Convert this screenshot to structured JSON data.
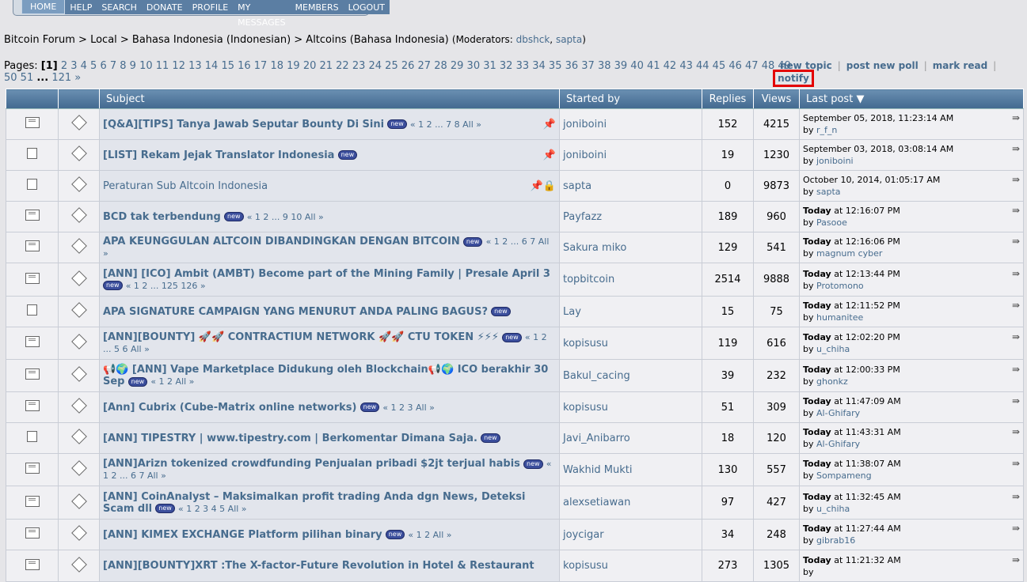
{
  "menu": [
    "HOME",
    "HELP",
    "SEARCH",
    "DONATE",
    "PROFILE",
    "MY MESSAGES",
    "MEMBERS",
    "LOGOUT"
  ],
  "breadcrumb": {
    "path": "Bitcoin Forum > Local > Bahasa Indonesia (Indonesian) > Altcoins (Bahasa Indonesia)",
    "mods_prefix": "(Moderators: ",
    "mod1": "dbshck",
    "mod_sep": ", ",
    "mod2": "sapta",
    "mods_suffix": ")"
  },
  "pages": {
    "label": "Pages:",
    "current": "[1]",
    "list": "2 3 4 5 6 7 8 9 10 11 12 13 14 15 16 17 18 19 20 21 22 23 24 25 26 27 28 29 30 31 32 33 34 35 36 37 38 39 40 41 42 43 44 45 46 47 48 49",
    "list2": "50 51",
    "ellipsis": "...",
    "last": "121 »"
  },
  "actions": {
    "new_topic": "new topic",
    "new_poll": "post new poll",
    "mark_read": "mark read",
    "notify": "notify",
    "sep": "|"
  },
  "columns": {
    "subject": "Subject",
    "started_by": "Started by",
    "replies": "Replies",
    "views": "Views",
    "last_post": "Last post"
  },
  "topics": [
    {
      "subject": "[Q&A][TIPS] Tanya Jawab Seputar Bounty Di Sini",
      "new": true,
      "pages": "« 1 2 ... 7 8  All »",
      "pinned": true,
      "locked": false,
      "plain": false,
      "starter": "joniboini",
      "replies": "152",
      "views": "4215",
      "last_date": "September 05, 2018, 11:23:14 AM",
      "last_by": "r_f_n",
      "today": false,
      "hot": true
    },
    {
      "subject": "[LIST] Rekam Jejak Translator Indonesia",
      "new": true,
      "pages": "",
      "pinned": true,
      "locked": false,
      "plain": false,
      "starter": "joniboini",
      "replies": "19",
      "views": "1230",
      "last_date": "September 03, 2018, 03:08:14 AM",
      "last_by": "joniboini",
      "today": false,
      "hot": false
    },
    {
      "subject": "Peraturan Sub Altcoin Indonesia",
      "new": false,
      "pages": "",
      "pinned": true,
      "locked": true,
      "plain": true,
      "starter": "sapta",
      "replies": "0",
      "views": "9873",
      "last_date": "October 10, 2014, 01:05:17 AM",
      "last_by": "sapta",
      "today": false,
      "hot": false
    },
    {
      "subject": "BCD tak terbendung",
      "new": true,
      "pages": "« 1 2 ... 9 10  All »",
      "pinned": false,
      "locked": false,
      "plain": false,
      "starter": "Payfazz",
      "replies": "189",
      "views": "960",
      "last_date": "at 12:16:07 PM",
      "last_by": "Pasooe",
      "today": true,
      "hot": true
    },
    {
      "subject": "APA KEUNGGULAN ALTCOIN DIBANDINGKAN DENGAN BITCOIN",
      "new": true,
      "pages": "« 1 2 ... 6 7  All »",
      "pinned": false,
      "locked": false,
      "plain": false,
      "starter": "Sakura miko",
      "replies": "129",
      "views": "541",
      "last_date": "at 12:16:06 PM",
      "last_by": "magnum cyber",
      "today": true,
      "hot": true
    },
    {
      "subject": "[ANN] [ICO] Ambit (AMBT) Become part of the Mining Family | Presale April 3",
      "new": true,
      "pages": "« 1 2 ... 125 126 »",
      "pinned": false,
      "locked": false,
      "plain": false,
      "starter": "topbitcoin",
      "replies": "2514",
      "views": "9888",
      "last_date": "at 12:13:44 PM",
      "last_by": "Protomono",
      "today": true,
      "hot": true
    },
    {
      "subject": "APA SIGNATURE CAMPAIGN YANG MENURUT ANDA PALING BAGUS?",
      "new": true,
      "pages": "",
      "pinned": false,
      "locked": false,
      "plain": false,
      "starter": "Lay",
      "replies": "15",
      "views": "75",
      "last_date": "at 12:11:52 PM",
      "last_by": "humanitee",
      "today": true,
      "hot": false
    },
    {
      "subject": "[ANN][BOUNTY] 🚀🚀 CONTRACTIUM NETWORK 🚀🚀 CTU TOKEN ⚡⚡⚡",
      "new": true,
      "pages": "« 1 2 ... 5 6  All »",
      "pinned": false,
      "locked": false,
      "plain": false,
      "starter": "kopisusu",
      "replies": "119",
      "views": "616",
      "last_date": "at 12:02:20 PM",
      "last_by": "u_chiha",
      "today": true,
      "hot": true
    },
    {
      "subject": "📢🌍 [ANN] Vape Marketplace Didukung oleh Blockchain📢🌍 ICO berakhir 30 Sep",
      "new": true,
      "pages": "« 1 2  All »",
      "pinned": false,
      "locked": false,
      "plain": false,
      "starter": "Bakul_cacing",
      "replies": "39",
      "views": "232",
      "last_date": "at 12:00:33 PM",
      "last_by": "ghonkz",
      "today": true,
      "hot": true
    },
    {
      "subject": "[Ann] Cubrix (Cube-Matrix online networks)",
      "new": true,
      "pages": "« 1 2 3  All »",
      "pinned": false,
      "locked": false,
      "plain": false,
      "starter": "kopisusu",
      "replies": "51",
      "views": "309",
      "last_date": "at 11:47:09 AM",
      "last_by": "Al-Ghifary",
      "today": true,
      "hot": true
    },
    {
      "subject": "[ANN] TIPESTRY | www.tipestry.com | Berkomentar Dimana Saja.",
      "new": true,
      "pages": "",
      "pinned": false,
      "locked": false,
      "plain": false,
      "starter": "Javi_Anibarro",
      "replies": "18",
      "views": "120",
      "last_date": "at 11:43:31 AM",
      "last_by": "Al-Ghifary",
      "today": true,
      "hot": false
    },
    {
      "subject": "[ANN]Arizn tokenized crowdfunding Penjualan pribadi $2jt terjual habis",
      "new": true,
      "pages": "« 1 2 ... 6 7  All »",
      "pinned": false,
      "locked": false,
      "plain": false,
      "starter": "Wakhid Mukti",
      "replies": "130",
      "views": "557",
      "last_date": "at 11:38:07 AM",
      "last_by": "Sompameng",
      "today": true,
      "hot": true
    },
    {
      "subject": "[ANN] CoinAnalyst – Maksimalkan profit trading Anda dgn News, Deteksi Scam dll",
      "new": true,
      "pages": "« 1 2 3 4 5  All »",
      "pinned": false,
      "locked": false,
      "plain": false,
      "starter": "alexsetiawan",
      "replies": "97",
      "views": "427",
      "last_date": "at 11:32:45 AM",
      "last_by": "u_chiha",
      "today": true,
      "hot": true
    },
    {
      "subject": "[ANN] KIMEX EXCHANGE Platform pilihan binary",
      "new": true,
      "pages": "« 1 2  All »",
      "pinned": false,
      "locked": false,
      "plain": false,
      "starter": "joycigar",
      "replies": "34",
      "views": "248",
      "last_date": "at 11:27:44 AM",
      "last_by": "gibrab16",
      "today": true,
      "hot": true
    },
    {
      "subject": "[ANN][BOUNTY]XRT :The X-factor-Future Revolution in Hotel & Restaurant",
      "new": false,
      "pages": "",
      "pinned": false,
      "locked": false,
      "plain": false,
      "starter": "kopisusu",
      "replies": "273",
      "views": "1305",
      "last_date": "at 11:21:32 AM",
      "last_by": "",
      "today": true,
      "hot": true
    }
  ],
  "today_label": "Today",
  "by_label": "by",
  "new_badge": "new"
}
